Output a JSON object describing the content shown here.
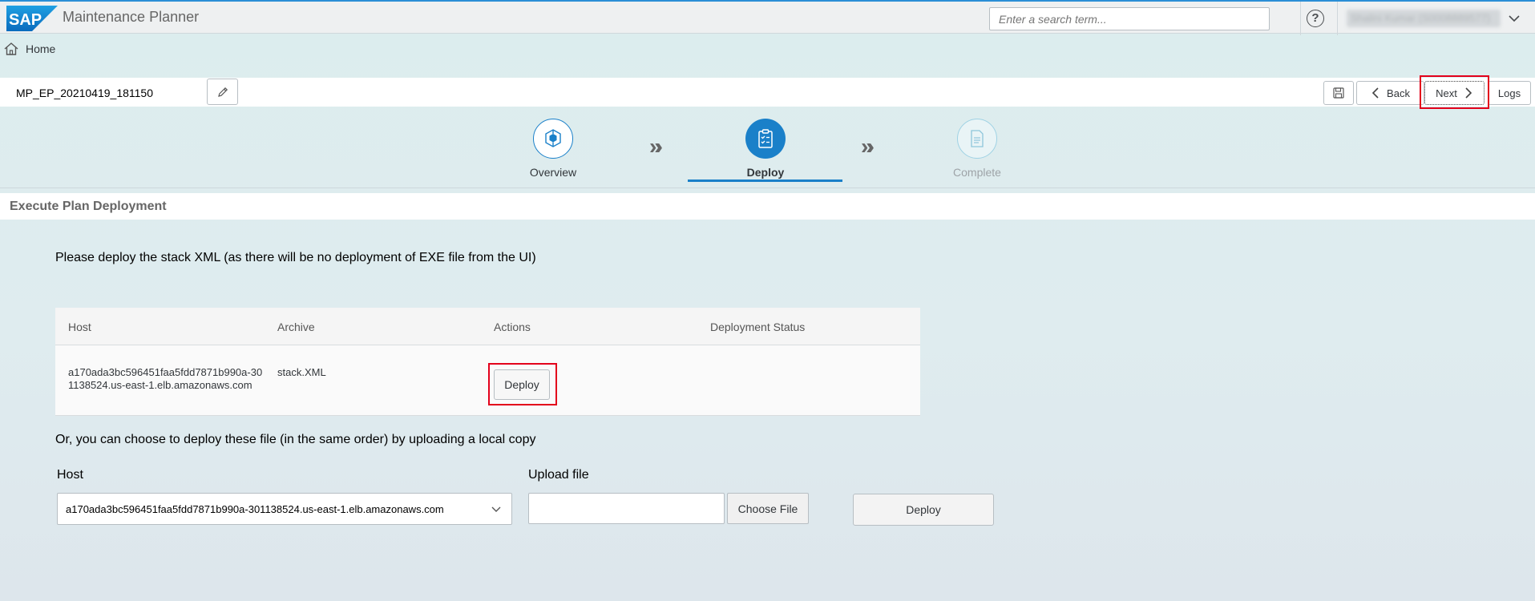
{
  "shell": {
    "logo_text": "SAP",
    "app_title": "Maintenance Planner",
    "search_placeholder": "Enter a search term...",
    "help_glyph": "?",
    "user_name": "Shalini Kumar (S0008889577)"
  },
  "breadcrumb": {
    "home_label": "Home"
  },
  "toolbar": {
    "plan_name": "MP_EP_20210419_181150",
    "back_label": "Back",
    "next_label": "Next",
    "logs_label": "Logs"
  },
  "steps": [
    {
      "label": "Overview",
      "state": "done"
    },
    {
      "label": "Deploy",
      "state": "active"
    },
    {
      "label": "Complete",
      "state": "pending"
    }
  ],
  "section": {
    "title": "Execute Plan Deployment"
  },
  "instruction": "Please deploy the stack XML (as there will be no deployment of EXE file from the UI)",
  "table": {
    "columns": [
      "Host",
      "Archive",
      "Actions",
      "Deployment Status"
    ],
    "rows": [
      {
        "host": "a170ada3bc596451faa5fdd7871b990a-301138524.us-east-1.elb.amazonaws.com",
        "archive": "stack.XML",
        "action_label": "Deploy",
        "status": ""
      }
    ]
  },
  "upload": {
    "intro": "Or, you can choose to deploy these file (in the same order) by uploading a local copy",
    "host_label": "Host",
    "host_value": "a170ada3bc596451faa5fdd7871b990a-301138524.us-east-1.elb.amazonaws.com",
    "file_label": "Upload file",
    "choose_label": "Choose File",
    "deploy_label": "Deploy"
  },
  "colors": {
    "accent": "#1a80c9",
    "highlight": "#e3001b",
    "shell_bg": "#eef0f1",
    "page_bg": "#dcedee"
  },
  "icons": {
    "home": "home-icon",
    "edit": "pencil-icon",
    "save": "save-icon",
    "back": "chevron-left-icon",
    "next": "chevron-right-icon",
    "overview": "overview-cube-icon",
    "deploy": "clipboard-checklist-icon",
    "complete": "document-icon",
    "dropdown": "chevron-down-icon"
  }
}
